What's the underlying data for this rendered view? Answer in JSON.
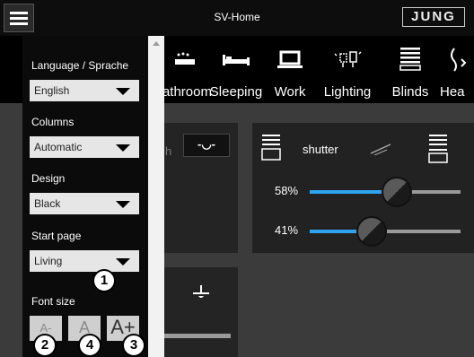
{
  "topbar": {
    "title": "SV-Home",
    "brand": "JUNG"
  },
  "categories": [
    {
      "label": "Bathroom",
      "icon": "bath-icon"
    },
    {
      "label": "Sleeping",
      "icon": "bed-icon"
    },
    {
      "label": "Work",
      "icon": "laptop-icon"
    },
    {
      "label": "Lighting",
      "icon": "light-bulb-icon"
    },
    {
      "label": "Blinds",
      "icon": "blinds-icon"
    },
    {
      "label": "Hea",
      "icon": "heating-icon"
    }
  ],
  "menu": {
    "language_label": "Language / Sprache",
    "language_value": "English",
    "columns_label": "Columns",
    "columns_value": "Automatic",
    "design_label": "Design",
    "design_value": "Black",
    "startpage_label": "Start page",
    "startpage_value": "Living",
    "fontsize_label": "Font size",
    "font_small": "A-",
    "font_normal": "A",
    "font_large": "A+"
  },
  "tiles": {
    "switch_button": "-◡-",
    "shutter_name": "shutter",
    "shutter_position_pct": "58%",
    "shutter_position_value": 0.58,
    "shutter_slat_pct": "41%",
    "shutter_slat_value": 0.41
  },
  "callouts": [
    "1",
    "2",
    "4",
    "3"
  ],
  "colors": {
    "accent": "#2ea3ee",
    "background": "#3b3b3b",
    "drawer": "#0b0b0b"
  }
}
